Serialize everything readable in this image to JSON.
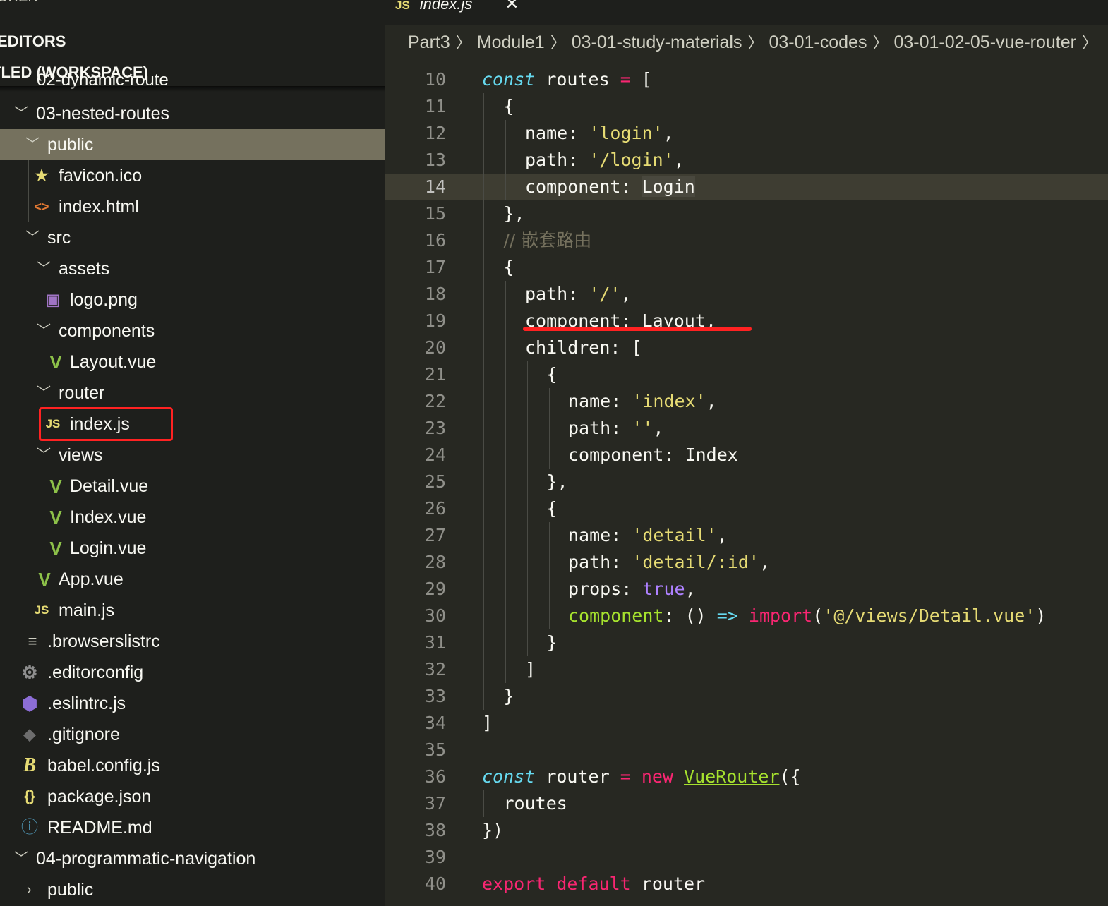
{
  "sidebar": {
    "explorer_label": "ORER",
    "more_actions": "···",
    "open_editors": "EDITORS",
    "workspace": "TLED (WORKSPACE)",
    "partial_row": "02-dynamic-route",
    "tree": [
      {
        "label": "03-nested-routes",
        "twisty": "open"
      },
      {
        "label": "public",
        "twisty": "open"
      },
      {
        "label": "favicon.ico",
        "icon": "★"
      },
      {
        "label": "index.html",
        "icon": "<>"
      },
      {
        "label": "src",
        "twisty": "open"
      },
      {
        "label": "assets",
        "twisty": "open"
      },
      {
        "label": "logo.png",
        "icon": "▣"
      },
      {
        "label": "components",
        "twisty": "open"
      },
      {
        "label": "Layout.vue",
        "icon": "V"
      },
      {
        "label": "router",
        "twisty": "open"
      },
      {
        "label": "index.js",
        "icon": "JS"
      },
      {
        "label": "views",
        "twisty": "open"
      },
      {
        "label": "Detail.vue",
        "icon": "V"
      },
      {
        "label": "Index.vue",
        "icon": "V"
      },
      {
        "label": "Login.vue",
        "icon": "V"
      },
      {
        "label": "App.vue",
        "icon": "V"
      },
      {
        "label": "main.js",
        "icon": "JS"
      },
      {
        "label": ".browserslistrc",
        "icon": "≡"
      },
      {
        "label": ".editorconfig",
        "icon": "⚙"
      },
      {
        "label": ".eslintrc.js",
        "icon": "⬢"
      },
      {
        "label": ".gitignore",
        "icon": "◆"
      },
      {
        "label": "babel.config.js",
        "icon": "B"
      },
      {
        "label": "package.json",
        "icon": "{}"
      },
      {
        "label": "README.md",
        "icon": "ⓘ"
      },
      {
        "label": "04-programmatic-navigation",
        "twisty": "open"
      },
      {
        "label": "public",
        "twisty": "closed"
      }
    ]
  },
  "editor": {
    "tab": {
      "icon_text": "JS",
      "label": "index.js",
      "close": "✕"
    },
    "breadcrumb": [
      "Part3",
      "Module1",
      "03-01-study-materials",
      "03-01-codes",
      "03-01-02-05-vue-router",
      ""
    ],
    "active_line": 14,
    "lines": [
      {
        "n": "10",
        "t": "const routes = ["
      },
      {
        "n": "11",
        "t": "{"
      },
      {
        "n": "12",
        "t": "name: 'login',"
      },
      {
        "n": "13",
        "t": "path: '/login',"
      },
      {
        "n": "14",
        "t": "component: Login"
      },
      {
        "n": "15",
        "t": "},"
      },
      {
        "n": "16",
        "t": "// 嵌套路由"
      },
      {
        "n": "17",
        "t": "{"
      },
      {
        "n": "18",
        "t": "path: '/',"
      },
      {
        "n": "19",
        "t": "component: Layout,"
      },
      {
        "n": "20",
        "t": "children: ["
      },
      {
        "n": "21",
        "t": "{"
      },
      {
        "n": "22",
        "t": "name: 'index',"
      },
      {
        "n": "23",
        "t": "path: '',"
      },
      {
        "n": "24",
        "t": "component: Index"
      },
      {
        "n": "25",
        "t": "},"
      },
      {
        "n": "26",
        "t": "{"
      },
      {
        "n": "27",
        "t": "name: 'detail',"
      },
      {
        "n": "28",
        "t": "path: 'detail/:id',"
      },
      {
        "n": "29",
        "t": "props: true,"
      },
      {
        "n": "30",
        "t": "component: () => import('@/views/Detail.vue')"
      },
      {
        "n": "31",
        "t": "}"
      },
      {
        "n": "32",
        "t": "]"
      },
      {
        "n": "33",
        "t": "}"
      },
      {
        "n": "34",
        "t": "]"
      },
      {
        "n": "35",
        "t": ""
      },
      {
        "n": "36",
        "t": "const router = new VueRouter({"
      },
      {
        "n": "37",
        "t": "routes"
      },
      {
        "n": "38",
        "t": "})"
      },
      {
        "n": "39",
        "t": ""
      },
      {
        "n": "40",
        "t": "export default router"
      }
    ]
  },
  "colors": {
    "keyword": "#66d9ef",
    "operator": "#f92672",
    "string": "#e6db74",
    "number": "#ae81ff",
    "function": "#a6e22e",
    "comment": "#75715e",
    "annotation": "#ff2222"
  }
}
